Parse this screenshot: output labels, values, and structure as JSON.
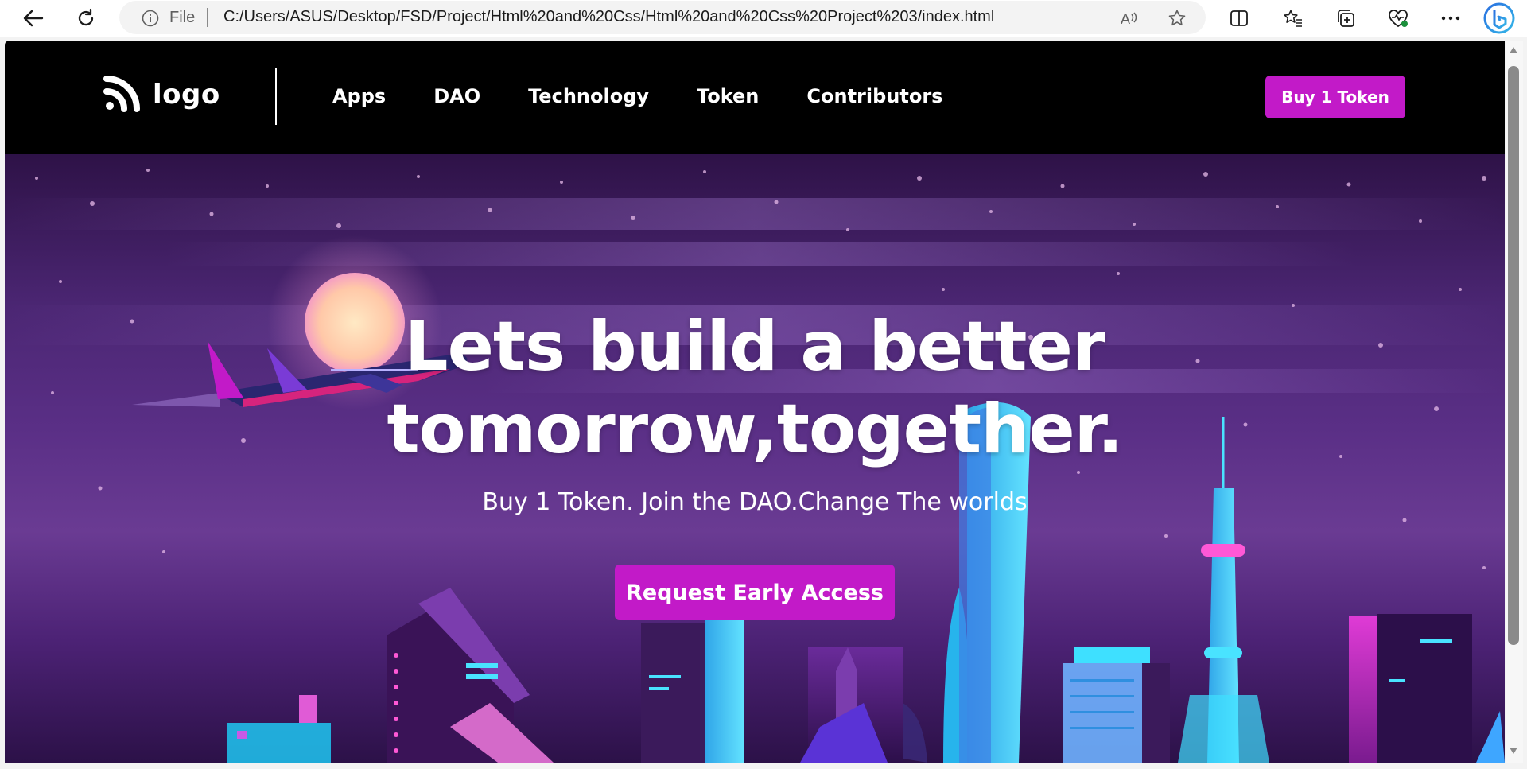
{
  "browser": {
    "file_label": "File",
    "url": "C:/Users/ASUS/Desktop/FSD/Project/Html%20and%20Css/Html%20and%20Css%20Project%203/index.html",
    "icons": [
      "back-arrow-icon",
      "refresh-icon",
      "info-icon",
      "read-aloud-icon",
      "favorite-star-icon",
      "split-screen-icon",
      "favorites-icon",
      "collections-icon",
      "browser-essentials-icon",
      "more-icon",
      "bing-icon"
    ]
  },
  "site": {
    "logo_text": "logo",
    "nav": [
      "Apps",
      "DAO",
      "Technology",
      "Token",
      "Contributors"
    ],
    "buy_button": "Buy 1 Token"
  },
  "hero": {
    "title_line1": "Lets build a better",
    "title_line2": "tomorrow,together.",
    "subtitle": "Buy 1 Token. Join the DAO.Change The worlds",
    "cta": "Request Early Access"
  },
  "colors": {
    "accent": "#c21ac8",
    "header_bg": "#000000",
    "hero_purple": "#5a2f86"
  }
}
